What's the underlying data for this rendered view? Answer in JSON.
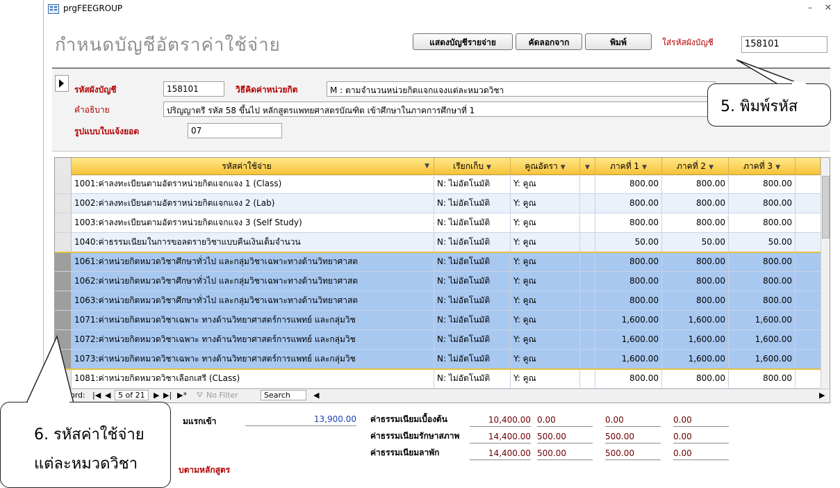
{
  "window": {
    "title": "prgFEEGROUP",
    "minimize": "–",
    "close": "✕"
  },
  "form": {
    "title": "กำหนดบัญชีอัตราค่าใช้จ่าย"
  },
  "toolbar": {
    "show_button": "แสดงบัญชีรายจ่าย",
    "copy_button": "คัดลอกจาก",
    "print_button": "พิมพ์",
    "account_label": "ใส่รหัสผังบัญชี",
    "account_value": "158101"
  },
  "header": {
    "account_code_label": "รหัสผังบัญชี",
    "account_code_value": "158101",
    "calc_method_label": "วิธีคิดค่าหน่วยกิต",
    "calc_method_value": "M : ตามจำนวนหน่วยกิตแจกแจงแต่ละหมวดวิชา",
    "description_label": "คำอธิบาย",
    "description_value": "ปริญญาตรี รหัส 58 ขึ้นไป หลักสูตรแพทยศาสตรบัณฑิต เข้าศึกษาในภาคการศึกษาที่ 1",
    "form_type_label": "รูปแบบใบแจ้งยอด",
    "form_type_value": "07"
  },
  "grid": {
    "columns": [
      "รหัสค่าใช้จ่าย",
      "เรียกเก็บ",
      "คูณอัตรา",
      "",
      "ภาคที่ 1",
      "ภาคที่ 2",
      "ภาคที่ 3"
    ],
    "rows": [
      {
        "code": "1001:ค่าลงทะเบียนตามอัตราหน่วยกิตแจกแจง 1 (Class)",
        "collect": "N: ไม่อัตโนมัติ",
        "mult": "Y: คูณ",
        "t1": "800.00",
        "t2": "800.00",
        "t3": "800.00",
        "state": "normal"
      },
      {
        "code": "1002:ค่าลงทะเบียนตามอัตราหน่วยกิตแจกแจง 2 (Lab)",
        "collect": "N: ไม่อัตโนมัติ",
        "mult": "Y: คูณ",
        "t1": "800.00",
        "t2": "800.00",
        "t3": "800.00",
        "state": "alt"
      },
      {
        "code": "1003:ค่าลงทะเบียนตามอัตราหน่วยกิตแจกแจง 3 (Self Study)",
        "collect": "N: ไม่อัตโนมัติ",
        "mult": "Y: คูณ",
        "t1": "800.00",
        "t2": "800.00",
        "t3": "800.00",
        "state": "normal"
      },
      {
        "code": "1040:ค่าธรรมเนียมในการขอลดรายวิชาแบบคืนเงินเต็มจำนวน",
        "collect": "N: ไม่อัตโนมัติ",
        "mult": "Y: คูณ",
        "t1": "50.00",
        "t2": "50.00",
        "t3": "50.00",
        "state": "alt"
      },
      {
        "code": "1061:ค่าหน่วยกิตหมวดวิชาศึกษาทั่วไป และกลุ่มวิชาเฉพาะทางด้านวิทยาศาสต",
        "collect": "N: ไม่อัตโนมัติ",
        "mult": "Y: คูณ",
        "t1": "800.00",
        "t2": "800.00",
        "t3": "800.00",
        "state": "sel"
      },
      {
        "code": "1062:ค่าหน่วยกิตหมวดวิชาศึกษาทั่วไป และกลุ่มวิชาเฉพาะทางด้านวิทยาศาสต",
        "collect": "N: ไม่อัตโนมัติ",
        "mult": "Y: คูณ",
        "t1": "800.00",
        "t2": "800.00",
        "t3": "800.00",
        "state": "sel"
      },
      {
        "code": "1063:ค่าหน่วยกิตหมวดวิชาศึกษาทั่วไป และกลุ่มวิชาเฉพาะทางด้านวิทยาศาสต",
        "collect": "N: ไม่อัตโนมัติ",
        "mult": "Y: คูณ",
        "t1": "800.00",
        "t2": "800.00",
        "t3": "800.00",
        "state": "sel"
      },
      {
        "code": "1071:ค่าหน่วยกิตหมวดวิชาเฉพาะ ทางด้านวิทยาศาสตร์การแพทย์ และกลุ่มวิช",
        "collect": "N: ไม่อัตโนมัติ",
        "mult": "Y: คูณ",
        "t1": "1,600.00",
        "t2": "1,600.00",
        "t3": "1,600.00",
        "state": "sel"
      },
      {
        "code": "1072:ค่าหน่วยกิตหมวดวิชาเฉพาะ ทางด้านวิทยาศาสตร์การแพทย์ และกลุ่มวิช",
        "collect": "N: ไม่อัตโนมัติ",
        "mult": "Y: คูณ",
        "t1": "1,600.00",
        "t2": "1,600.00",
        "t3": "1,600.00",
        "state": "sel"
      },
      {
        "code": "1073:ค่าหน่วยกิตหมวดวิชาเฉพาะ ทางด้านวิทยาศาสตร์การแพทย์ และกลุ่มวิช",
        "collect": "N: ไม่อัตโนมัติ",
        "mult": "Y: คูณ",
        "t1": "1,600.00",
        "t2": "1,600.00",
        "t3": "1,600.00",
        "state": "sel"
      },
      {
        "code": "1081:ค่าหน่วยกิตหมวดวิชาเลือกเสรี (CLass)",
        "collect": "N: ไม่อัตโนมัติ",
        "mult": "Y: คูณ",
        "t1": "800.00",
        "t2": "800.00",
        "t3": "800.00",
        "state": "normal"
      }
    ],
    "nav": {
      "record_prefix": "ord:",
      "position": "5 of 21",
      "filter": "No Filter",
      "search": "Search"
    }
  },
  "footer": {
    "entry_label_partial": "มแรกเข้า",
    "entry_value": "13,900.00",
    "fee_rows": [
      {
        "label": "ค่าธรรมเนียมเบื้องต้น",
        "v1": "10,400.00",
        "v2": "0.00",
        "v3": "0.00",
        "v4": "0.00"
      },
      {
        "label": "ค่าธรรมเนียมรักษาสภาพ",
        "v1": "14,400.00",
        "v2": "500.00",
        "v3": "500.00",
        "v4": "0.00"
      },
      {
        "label": "ค่าธรรมเนียมลาพัก",
        "v1": "14,400.00",
        "v2": "500.00",
        "v3": "500.00",
        "v4": "0.00"
      }
    ],
    "bottom_label_partial": "บตามหลักสูตร"
  },
  "callouts": {
    "type_code": "5. พิมพ์รหัส",
    "expense_line1": "6. รหัสค่าใช้จ่าย",
    "expense_line2": "แต่ละหมวดวิชา"
  },
  "colors": {
    "selected_row": "#a8c8f0",
    "header": "#f7c23a",
    "label_red": "#b00000",
    "value_maroon": "#6b0000"
  }
}
